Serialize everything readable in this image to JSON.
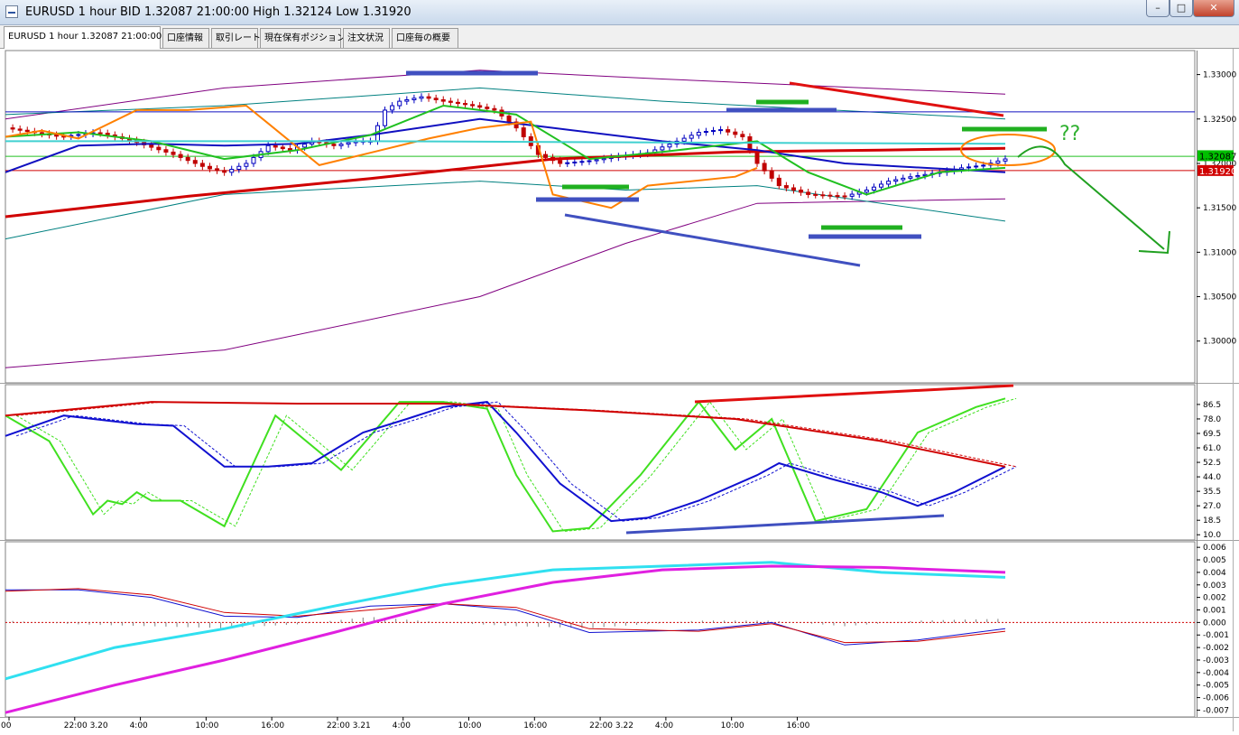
{
  "window": {
    "title": "EURUSD 1 hour BID 1.32087 21:00:00 High 1.32124 Low 1.31920",
    "min_glyph": "–",
    "max_glyph": "□",
    "close_glyph": "✕"
  },
  "tabs": [
    {
      "label": "EURUSD 1 hour 1.32087 21:00:00",
      "active": true
    },
    {
      "label": "口座情報"
    },
    {
      "label": "取引レート"
    },
    {
      "label": "現在保有ポジション"
    },
    {
      "label": "注文状況"
    },
    {
      "label": "口座毎の概要"
    }
  ],
  "colors": {
    "price_up": "#0000c0",
    "price_down": "#c00000",
    "current_price_bg": "#00c000",
    "low_price_bg": "#d00000",
    "annotation_orange": "#ff8000",
    "annotation_green": "#20a020",
    "annotation_blue": "#4050c0"
  },
  "annotations": {
    "question": "??"
  },
  "chart_data": [
    {
      "type": "candlestick",
      "symbol": "EURUSD",
      "timeframe": "1 hour",
      "ylim": [
        1.2955,
        1.3325
      ],
      "y_ticks": [
        "1.33000",
        "1.32500",
        "1.32000",
        "1.31500",
        "1.31000",
        "1.30500",
        "1.30000"
      ],
      "current_price": "1.32087",
      "low_price": "1.31920",
      "x_ticks": [
        ":00",
        "22:00 3.20",
        "4:00",
        "10:00",
        "16:00",
        "22:00 3.21",
        "4:00",
        "10:00",
        "16:00",
        "22:00 3.22",
        "4:00",
        "10:00",
        "16:00"
      ],
      "close_path": [
        [
          0,
          1.324
        ],
        [
          15,
          1.323
        ],
        [
          25,
          1.3235
        ],
        [
          35,
          1.3225
        ],
        [
          46,
          1.321
        ],
        [
          55,
          1.3195
        ],
        [
          60,
          1.319
        ],
        [
          66,
          1.32
        ],
        [
          72,
          1.322
        ],
        [
          78,
          1.3215
        ],
        [
          84,
          1.3225
        ],
        [
          90,
          1.322
        ],
        [
          96,
          1.3225
        ],
        [
          100,
          1.3225
        ],
        [
          104,
          1.326
        ],
        [
          108,
          1.327
        ],
        [
          114,
          1.3275
        ],
        [
          120,
          1.327
        ],
        [
          128,
          1.3265
        ],
        [
          134,
          1.326
        ],
        [
          140,
          1.324
        ],
        [
          146,
          1.321
        ],
        [
          152,
          1.32
        ],
        [
          160,
          1.3203
        ],
        [
          168,
          1.3208
        ],
        [
          176,
          1.3212
        ],
        [
          184,
          1.3225
        ],
        [
          190,
          1.3235
        ],
        [
          196,
          1.3238
        ],
        [
          202,
          1.323
        ],
        [
          206,
          1.32
        ],
        [
          212,
          1.3175
        ],
        [
          220,
          1.3165
        ],
        [
          230,
          1.3163
        ],
        [
          236,
          1.317
        ],
        [
          242,
          1.318
        ],
        [
          248,
          1.3185
        ],
        [
          256,
          1.319
        ],
        [
          262,
          1.3195
        ],
        [
          268,
          1.3198
        ],
        [
          274,
          1.3205
        ]
      ],
      "ma_lines": [
        {
          "name": "",
          "color": "#d00000",
          "values": [
            [
              0,
              1.314
            ],
            [
              50,
              1.3163
            ],
            [
              100,
              1.3183
            ],
            [
              150,
              1.3205
            ],
            [
              200,
              1.3213
            ],
            [
              240,
              1.3215
            ],
            [
              274,
              1.3217
            ]
          ]
        },
        {
          "name": "",
          "color": "#1010c0",
          "values": [
            [
              0,
              1.319
            ],
            [
              20,
              1.322
            ],
            [
              40,
              1.3222
            ],
            [
              60,
              1.322
            ],
            [
              80,
              1.3222
            ],
            [
              100,
              1.3232
            ],
            [
              130,
              1.325
            ],
            [
              150,
              1.324
            ],
            [
              180,
              1.3225
            ],
            [
              206,
              1.3215
            ],
            [
              230,
              1.32
            ],
            [
              274,
              1.319
            ]
          ]
        },
        {
          "name": "",
          "color": "#20c020",
          "values": [
            [
              0,
              1.323
            ],
            [
              20,
              1.3235
            ],
            [
              40,
              1.3225
            ],
            [
              60,
              1.3205
            ],
            [
              80,
              1.3215
            ],
            [
              100,
              1.3232
            ],
            [
              120,
              1.3265
            ],
            [
              140,
              1.3255
            ],
            [
              160,
              1.3205
            ],
            [
              180,
              1.3213
            ],
            [
              206,
              1.3225
            ],
            [
              220,
              1.319
            ],
            [
              236,
              1.3165
            ],
            [
              256,
              1.319
            ],
            [
              274,
              1.3195
            ]
          ]
        },
        {
          "name": "",
          "color": "#ff8000",
          "values": [
            [
              0,
              1.323
            ],
            [
              10,
              1.3237
            ],
            [
              20,
              1.3228
            ],
            [
              36,
              1.326
            ],
            [
              50,
              1.326
            ],
            [
              66,
              1.3265
            ],
            [
              72,
              1.3245
            ],
            [
              86,
              1.3198
            ],
            [
              100,
              1.3212
            ],
            [
              116,
              1.3228
            ],
            [
              130,
              1.324
            ],
            [
              144,
              1.3247
            ],
            [
              150,
              1.3165
            ],
            [
              166,
              1.315
            ],
            [
              176,
              1.3175
            ],
            [
              200,
              1.3185
            ],
            [
              206,
              1.3195
            ]
          ]
        },
        {
          "name": "",
          "color": "#40d0d0",
          "values": [
            [
              0,
              1.3225
            ],
            [
              100,
              1.3225
            ],
            [
              274,
              1.3222
            ]
          ]
        }
      ],
      "bands": [
        {
          "color": "#800080",
          "upper": [
            [
              0,
              1.325
            ],
            [
              60,
              1.3285
            ],
            [
              130,
              1.3305
            ],
            [
              180,
              1.3295
            ],
            [
              274,
              1.3278
            ]
          ],
          "lower": [
            [
              0,
              1.297
            ],
            [
              60,
              1.299
            ],
            [
              130,
              1.305
            ],
            [
              170,
              1.311
            ],
            [
              206,
              1.3155
            ],
            [
              274,
              1.316
            ]
          ]
        },
        {
          "color": "#008080",
          "upper": [
            [
              0,
              1.3255
            ],
            [
              60,
              1.3265
            ],
            [
              130,
              1.3285
            ],
            [
              180,
              1.327
            ],
            [
              274,
              1.325
            ]
          ],
          "lower": [
            [
              0,
              1.3115
            ],
            [
              60,
              1.3165
            ],
            [
              130,
              1.318
            ],
            [
              170,
              1.317
            ],
            [
              206,
              1.3175
            ],
            [
              274,
              1.3135
            ]
          ]
        }
      ],
      "levels": [
        {
          "color": "#1010c0",
          "price": 1.3258,
          "from": 0,
          "to": 274
        },
        {
          "color": "#d00000",
          "price": 1.3192,
          "from": 0,
          "to": 274
        },
        {
          "color": "#20c020",
          "price": 1.3208,
          "from": 0,
          "to": 274
        }
      ]
    },
    {
      "type": "line",
      "indicator": "stochastic",
      "ylim": [
        8.0,
        96.0
      ],
      "y_ticks": [
        "86.5",
        "78.0",
        "69.5",
        "61.0",
        "52.5",
        "44.0",
        "35.5",
        "27.0",
        "18.5",
        "10.0"
      ],
      "series": [
        {
          "name": "",
          "color": "#40e020",
          "values": [
            [
              0,
              80
            ],
            [
              12,
              65
            ],
            [
              24,
              22
            ],
            [
              28,
              30
            ],
            [
              32,
              28
            ],
            [
              36,
              35
            ],
            [
              40,
              30
            ],
            [
              48,
              30
            ],
            [
              60,
              15
            ],
            [
              74,
              80
            ],
            [
              92,
              48
            ],
            [
              108,
              88
            ],
            [
              120,
              88
            ],
            [
              132,
              84
            ],
            [
              140,
              45
            ],
            [
              150,
              12
            ],
            [
              160,
              14
            ],
            [
              174,
              45
            ],
            [
              190,
              88
            ],
            [
              200,
              60
            ],
            [
              210,
              78
            ],
            [
              222,
              18
            ],
            [
              236,
              25
            ],
            [
              250,
              70
            ],
            [
              266,
              85
            ],
            [
              274,
              90
            ]
          ]
        },
        {
          "name": "",
          "color": "#1010d0",
          "values": [
            [
              0,
              68
            ],
            [
              16,
              80
            ],
            [
              36,
              75
            ],
            [
              46,
              74
            ],
            [
              60,
              50
            ],
            [
              72,
              50
            ],
            [
              84,
              52
            ],
            [
              98,
              70
            ],
            [
              110,
              78
            ],
            [
              120,
              85
            ],
            [
              132,
              88
            ],
            [
              140,
              70
            ],
            [
              152,
              40
            ],
            [
              166,
              18
            ],
            [
              176,
              20
            ],
            [
              190,
              30
            ],
            [
              206,
              45
            ],
            [
              212,
              52
            ],
            [
              226,
              43
            ],
            [
              240,
              35
            ],
            [
              250,
              27
            ],
            [
              260,
              35
            ],
            [
              274,
              50
            ]
          ]
        },
        {
          "name": "",
          "color": "#d00000",
          "values": [
            [
              0,
              80
            ],
            [
              40,
              88
            ],
            [
              80,
              87
            ],
            [
              120,
              87
            ],
            [
              160,
              83
            ],
            [
              200,
              78
            ],
            [
              240,
              65
            ],
            [
              274,
              50
            ]
          ]
        }
      ]
    },
    {
      "type": "line",
      "indicator": "macd",
      "ylim": [
        -0.0074,
        0.0063
      ],
      "y_ticks": [
        "0.006",
        "0.005",
        "0.004",
        "0.003",
        "0.002",
        "0.001",
        "0.000",
        "-0.001",
        "-0.002",
        "-0.003",
        "-0.004",
        "-0.005",
        "-0.006",
        "-0.007"
      ],
      "series": [
        {
          "name": "",
          "color": "#1010d0",
          "values": [
            [
              0,
              0.0026
            ],
            [
              20,
              0.0026
            ],
            [
              40,
              0.002
            ],
            [
              60,
              0.0005
            ],
            [
              80,
              0.0004
            ],
            [
              100,
              0.0013
            ],
            [
              120,
              0.0015
            ],
            [
              140,
              0.001
            ],
            [
              160,
              -0.0008
            ],
            [
              190,
              -0.0006
            ],
            [
              210,
              0.0
            ],
            [
              230,
              -0.0018
            ],
            [
              250,
              -0.0014
            ],
            [
              274,
              -0.0005
            ]
          ]
        },
        {
          "name": "",
          "color": "#d00000",
          "values": [
            [
              0,
              0.0025
            ],
            [
              20,
              0.0027
            ],
            [
              40,
              0.0022
            ],
            [
              60,
              0.0008
            ],
            [
              80,
              0.0005
            ],
            [
              100,
              0.001
            ],
            [
              120,
              0.0015
            ],
            [
              140,
              0.0012
            ],
            [
              160,
              -0.0005
            ],
            [
              190,
              -0.0007
            ],
            [
              210,
              -0.0001
            ],
            [
              230,
              -0.0016
            ],
            [
              250,
              -0.0015
            ],
            [
              274,
              -0.0007
            ]
          ]
        },
        {
          "name": "",
          "color": "#30e0f0",
          "values": [
            [
              0,
              -0.0045
            ],
            [
              30,
              -0.002
            ],
            [
              60,
              -0.0005
            ],
            [
              90,
              0.0013
            ],
            [
              120,
              0.003
            ],
            [
              150,
              0.0042
            ],
            [
              180,
              0.0045
            ],
            [
              210,
              0.0048
            ],
            [
              240,
              0.004
            ],
            [
              274,
              0.0036
            ]
          ]
        },
        {
          "name": "",
          "color": "#e020e0",
          "values": [
            [
              0,
              -0.0072
            ],
            [
              30,
              -0.005
            ],
            [
              60,
              -0.003
            ],
            [
              90,
              -0.0008
            ],
            [
              120,
              0.0015
            ],
            [
              150,
              0.0032
            ],
            [
              180,
              0.0042
            ],
            [
              210,
              0.0045
            ],
            [
              240,
              0.0044
            ],
            [
              274,
              0.004
            ]
          ]
        }
      ]
    }
  ]
}
